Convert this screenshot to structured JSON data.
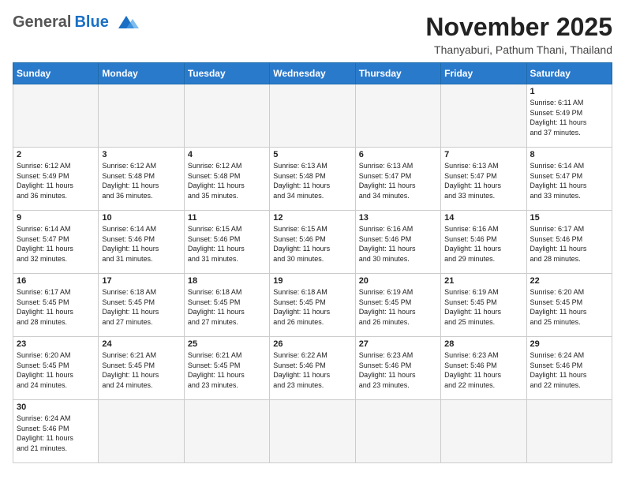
{
  "header": {
    "logo_general": "General",
    "logo_blue": "Blue",
    "month": "November 2025",
    "location": "Thanyaburi, Pathum Thani, Thailand"
  },
  "weekdays": [
    "Sunday",
    "Monday",
    "Tuesday",
    "Wednesday",
    "Thursday",
    "Friday",
    "Saturday"
  ],
  "weeks": [
    [
      {
        "day": "",
        "info": ""
      },
      {
        "day": "",
        "info": ""
      },
      {
        "day": "",
        "info": ""
      },
      {
        "day": "",
        "info": ""
      },
      {
        "day": "",
        "info": ""
      },
      {
        "day": "",
        "info": ""
      },
      {
        "day": "1",
        "info": "Sunrise: 6:11 AM\nSunset: 5:49 PM\nDaylight: 11 hours\nand 37 minutes."
      }
    ],
    [
      {
        "day": "2",
        "info": "Sunrise: 6:12 AM\nSunset: 5:49 PM\nDaylight: 11 hours\nand 36 minutes."
      },
      {
        "day": "3",
        "info": "Sunrise: 6:12 AM\nSunset: 5:48 PM\nDaylight: 11 hours\nand 36 minutes."
      },
      {
        "day": "4",
        "info": "Sunrise: 6:12 AM\nSunset: 5:48 PM\nDaylight: 11 hours\nand 35 minutes."
      },
      {
        "day": "5",
        "info": "Sunrise: 6:13 AM\nSunset: 5:48 PM\nDaylight: 11 hours\nand 34 minutes."
      },
      {
        "day": "6",
        "info": "Sunrise: 6:13 AM\nSunset: 5:47 PM\nDaylight: 11 hours\nand 34 minutes."
      },
      {
        "day": "7",
        "info": "Sunrise: 6:13 AM\nSunset: 5:47 PM\nDaylight: 11 hours\nand 33 minutes."
      },
      {
        "day": "8",
        "info": "Sunrise: 6:14 AM\nSunset: 5:47 PM\nDaylight: 11 hours\nand 33 minutes."
      }
    ],
    [
      {
        "day": "9",
        "info": "Sunrise: 6:14 AM\nSunset: 5:47 PM\nDaylight: 11 hours\nand 32 minutes."
      },
      {
        "day": "10",
        "info": "Sunrise: 6:14 AM\nSunset: 5:46 PM\nDaylight: 11 hours\nand 31 minutes."
      },
      {
        "day": "11",
        "info": "Sunrise: 6:15 AM\nSunset: 5:46 PM\nDaylight: 11 hours\nand 31 minutes."
      },
      {
        "day": "12",
        "info": "Sunrise: 6:15 AM\nSunset: 5:46 PM\nDaylight: 11 hours\nand 30 minutes."
      },
      {
        "day": "13",
        "info": "Sunrise: 6:16 AM\nSunset: 5:46 PM\nDaylight: 11 hours\nand 30 minutes."
      },
      {
        "day": "14",
        "info": "Sunrise: 6:16 AM\nSunset: 5:46 PM\nDaylight: 11 hours\nand 29 minutes."
      },
      {
        "day": "15",
        "info": "Sunrise: 6:17 AM\nSunset: 5:46 PM\nDaylight: 11 hours\nand 28 minutes."
      }
    ],
    [
      {
        "day": "16",
        "info": "Sunrise: 6:17 AM\nSunset: 5:45 PM\nDaylight: 11 hours\nand 28 minutes."
      },
      {
        "day": "17",
        "info": "Sunrise: 6:18 AM\nSunset: 5:45 PM\nDaylight: 11 hours\nand 27 minutes."
      },
      {
        "day": "18",
        "info": "Sunrise: 6:18 AM\nSunset: 5:45 PM\nDaylight: 11 hours\nand 27 minutes."
      },
      {
        "day": "19",
        "info": "Sunrise: 6:18 AM\nSunset: 5:45 PM\nDaylight: 11 hours\nand 26 minutes."
      },
      {
        "day": "20",
        "info": "Sunrise: 6:19 AM\nSunset: 5:45 PM\nDaylight: 11 hours\nand 26 minutes."
      },
      {
        "day": "21",
        "info": "Sunrise: 6:19 AM\nSunset: 5:45 PM\nDaylight: 11 hours\nand 25 minutes."
      },
      {
        "day": "22",
        "info": "Sunrise: 6:20 AM\nSunset: 5:45 PM\nDaylight: 11 hours\nand 25 minutes."
      }
    ],
    [
      {
        "day": "23",
        "info": "Sunrise: 6:20 AM\nSunset: 5:45 PM\nDaylight: 11 hours\nand 24 minutes."
      },
      {
        "day": "24",
        "info": "Sunrise: 6:21 AM\nSunset: 5:45 PM\nDaylight: 11 hours\nand 24 minutes."
      },
      {
        "day": "25",
        "info": "Sunrise: 6:21 AM\nSunset: 5:45 PM\nDaylight: 11 hours\nand 23 minutes."
      },
      {
        "day": "26",
        "info": "Sunrise: 6:22 AM\nSunset: 5:46 PM\nDaylight: 11 hours\nand 23 minutes."
      },
      {
        "day": "27",
        "info": "Sunrise: 6:23 AM\nSunset: 5:46 PM\nDaylight: 11 hours\nand 23 minutes."
      },
      {
        "day": "28",
        "info": "Sunrise: 6:23 AM\nSunset: 5:46 PM\nDaylight: 11 hours\nand 22 minutes."
      },
      {
        "day": "29",
        "info": "Sunrise: 6:24 AM\nSunset: 5:46 PM\nDaylight: 11 hours\nand 22 minutes."
      }
    ],
    [
      {
        "day": "30",
        "info": "Sunrise: 6:24 AM\nSunset: 5:46 PM\nDaylight: 11 hours\nand 21 minutes."
      },
      {
        "day": "",
        "info": ""
      },
      {
        "day": "",
        "info": ""
      },
      {
        "day": "",
        "info": ""
      },
      {
        "day": "",
        "info": ""
      },
      {
        "day": "",
        "info": ""
      },
      {
        "day": "",
        "info": ""
      }
    ]
  ]
}
